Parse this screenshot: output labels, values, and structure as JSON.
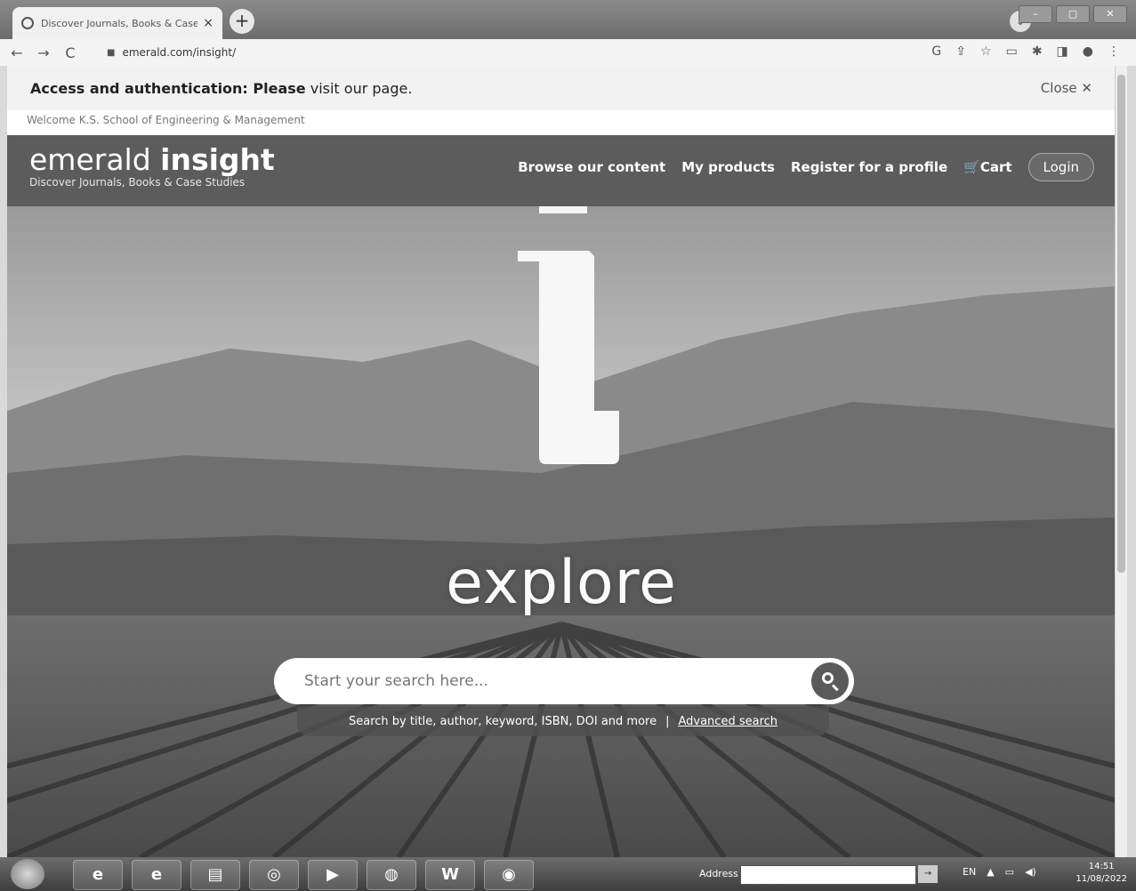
{
  "browser": {
    "tab_title": "Discover Journals, Books & Case",
    "tab_close": "×",
    "new_tab": "+",
    "url": "emerald.com/insight/"
  },
  "notice": {
    "text_bold": "Access and authentication: Please",
    "text_rest": " visit our page.",
    "close_label": "Close ✕"
  },
  "welcome": "Welcome K.S. School of Engineering & Management",
  "header": {
    "brand_light": "emerald ",
    "brand_bold": "insight",
    "tagline": "Discover Journals, Books & Case Studies",
    "nav": {
      "browse": "Browse our content",
      "products": "My products",
      "register": "Register for a profile",
      "cart": "Cart",
      "login": "Login"
    }
  },
  "hero": {
    "heading": "explore",
    "search_placeholder": "Start your search here...",
    "hint": "Search by title, author, keyword, ISBN, DOI and more",
    "separator": "|",
    "advanced": "Advanced search"
  },
  "taskbar": {
    "address_label": "Address",
    "lang": "EN",
    "time": "14:51",
    "date": "11/08/2022",
    "apps": [
      "e",
      "e",
      "",
      "",
      "",
      "",
      "W",
      ""
    ]
  }
}
